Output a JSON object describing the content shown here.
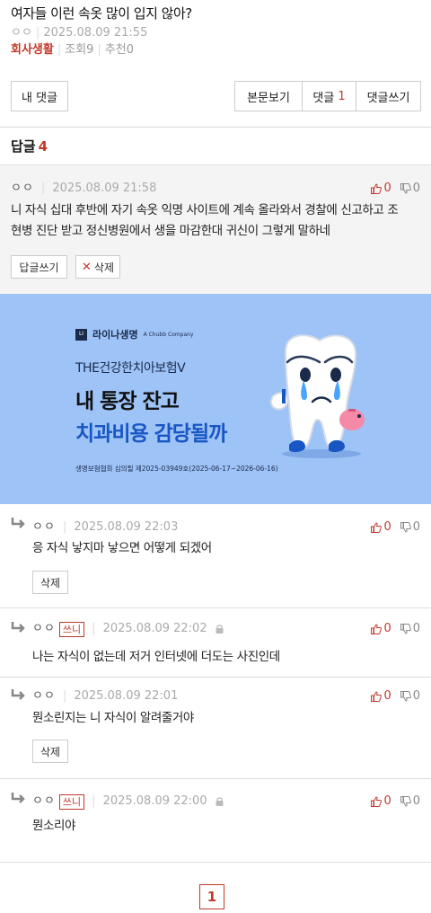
{
  "post": {
    "title": "여자들 이런 속옷 많이 입지 않아?",
    "author": "ㅇㅇ",
    "datetime": "2025.08.09 21:55",
    "category": "회사생활",
    "views": "조회9",
    "recommend": "추천0"
  },
  "toolbar": {
    "my_comments": "내 댓글",
    "view_post": "본문보기",
    "comments_label": "댓글",
    "comments_count": "1",
    "write_comment": "댓글쓰기"
  },
  "replies_header": {
    "label": "답글",
    "count": "4"
  },
  "colors": {
    "accent": "#c0392b",
    "ad_bg": "#9ec3f7",
    "ad_blue": "#1856c4"
  },
  "comments": [
    {
      "nick": "ㅇㅇ",
      "datetime": "2025.08.09 21:58",
      "up": "0",
      "down": "0",
      "text_line1": "니 자식 십대 후반에 자기 속옷 익명 사이트에 계속 올라와서 경찰에 신고하고 조",
      "text_line2": "현병 진단 받고 정신병원에서 생을 마감한대 귀신이 그렇게 말하네",
      "reply_btn": "답글쓰기",
      "delete_btn": "삭제"
    },
    {
      "nick": "ㅇㅇ",
      "datetime": "2025.08.09 22:03",
      "up": "0",
      "down": "0",
      "text": "응 자식 낳지마 낳으면 어떻게 되겠어",
      "delete_btn": "삭제"
    },
    {
      "nick": "ㅇㅇ",
      "badge": "쓰니",
      "datetime": "2025.08.09 22:02",
      "up": "0",
      "down": "0",
      "text": "나는 자식이 없는데 저거 인터넷에 더도는 사진인데"
    },
    {
      "nick": "ㅇㅇ",
      "datetime": "2025.08.09 22:01",
      "up": "0",
      "down": "0",
      "text": "뭔소린지는 니 자식이 알려줄거야",
      "delete_btn": "삭제"
    },
    {
      "nick": "ㅇㅇ",
      "badge": "쓰니",
      "datetime": "2025.08.09 22:00",
      "up": "0",
      "down": "0",
      "text": "뭔소리야"
    }
  ],
  "ad": {
    "brand": "라이나생명",
    "brand_sub": "A Chubb Company",
    "product": "THE건강한치아보험V",
    "headline1": "내 통장 잔고",
    "headline2": "치과비용 감당될까",
    "fine_print": "생명보험협회 심의필 제2025-03949호(2025-06-17~2026-06-16)"
  },
  "pagination": {
    "current": "1"
  },
  "icons": {
    "thumb_up": "thumbs-up-icon",
    "thumb_down": "thumbs-down-icon",
    "reply_arrow": "reply-arrow-icon",
    "lock": "lock-icon",
    "close": "close-icon"
  }
}
